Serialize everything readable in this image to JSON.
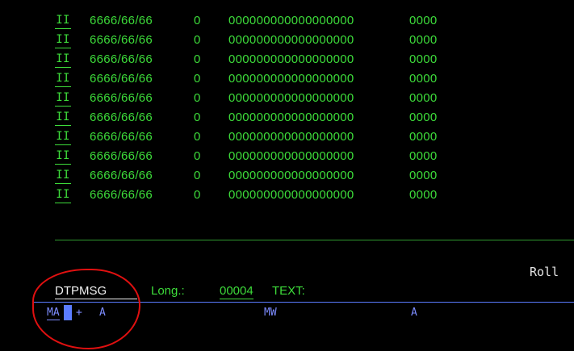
{
  "table": {
    "rows": [
      {
        "flag": "II",
        "date": "6666/66/66",
        "zero": "0",
        "num18": "000000000000000000",
        "num4": "0000"
      },
      {
        "flag": "II",
        "date": "6666/66/66",
        "zero": "0",
        "num18": "000000000000000000",
        "num4": "0000"
      },
      {
        "flag": "II",
        "date": "6666/66/66",
        "zero": "0",
        "num18": "000000000000000000",
        "num4": "0000"
      },
      {
        "flag": "II",
        "date": "6666/66/66",
        "zero": "0",
        "num18": "000000000000000000",
        "num4": "0000"
      },
      {
        "flag": "II",
        "date": "6666/66/66",
        "zero": "0",
        "num18": "000000000000000000",
        "num4": "0000"
      },
      {
        "flag": "II",
        "date": "6666/66/66",
        "zero": "0",
        "num18": "000000000000000000",
        "num4": "0000"
      },
      {
        "flag": "II",
        "date": "6666/66/66",
        "zero": "0",
        "num18": "000000000000000000",
        "num4": "0000"
      },
      {
        "flag": "II",
        "date": "6666/66/66",
        "zero": "0",
        "num18": "000000000000000000",
        "num4": "0000"
      },
      {
        "flag": "II",
        "date": "6666/66/66",
        "zero": "0",
        "num18": "000000000000000000",
        "num4": "0000"
      },
      {
        "flag": "II",
        "date": "6666/66/66",
        "zero": "0",
        "num18": "000000000000000000",
        "num4": "0000"
      }
    ]
  },
  "status": {
    "roll": "Roll"
  },
  "detail": {
    "field_name": "DTPMSG",
    "long_label": "Long.:",
    "long_value": "00004",
    "text_label": "TEXT:"
  },
  "attributes": {
    "ma_value": "MA",
    "plus": "+",
    "a1": "A",
    "mw": "MW",
    "a2": "A"
  },
  "colors": {
    "background": "#000000",
    "green": "#3ddc3a",
    "blue": "#7d8cff",
    "annotation": "#e01010"
  }
}
